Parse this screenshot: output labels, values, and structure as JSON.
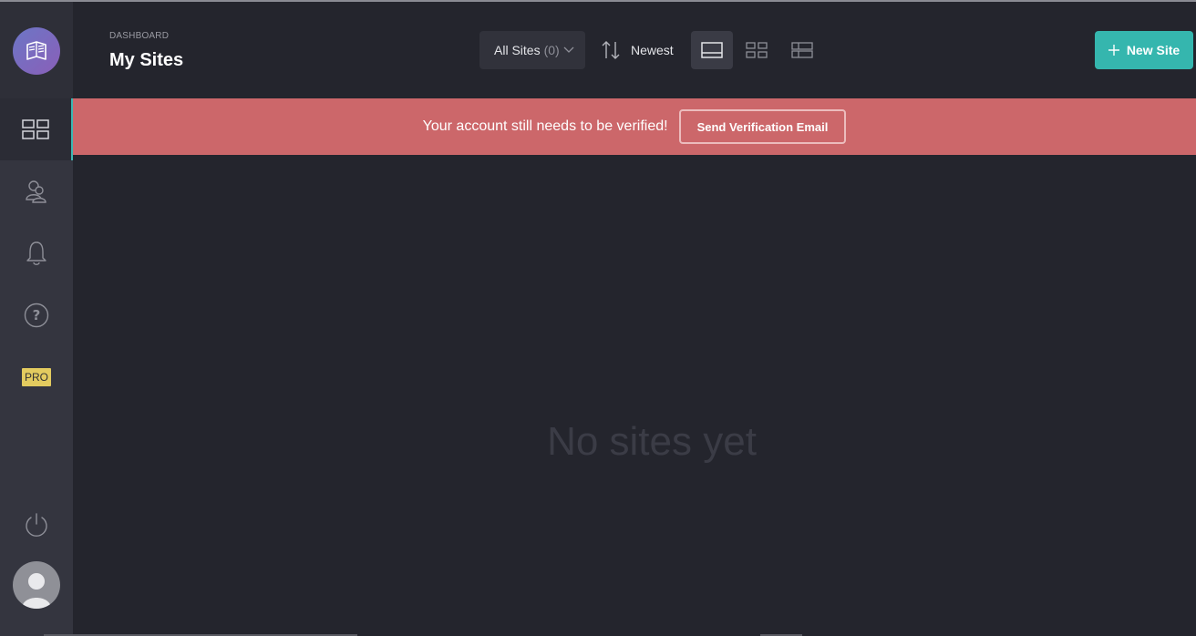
{
  "header": {
    "breadcrumb": "DASHBOARD",
    "title": "My Sites",
    "filter": {
      "label": "All Sites",
      "count": "(0)"
    },
    "sort": {
      "label": "Newest"
    },
    "new_site_label": "New Site"
  },
  "banner": {
    "message": "Your account still needs to be verified!",
    "button_label": "Send Verification Email"
  },
  "sidebar": {
    "pro_label": "PRO"
  },
  "main": {
    "empty_message": "No sites yet"
  },
  "colors": {
    "accent": "#35b6ae",
    "banner": "#cc676a",
    "pro_badge": "#e3cb5f",
    "background": "#24252d",
    "sidebar": "#34353f"
  }
}
